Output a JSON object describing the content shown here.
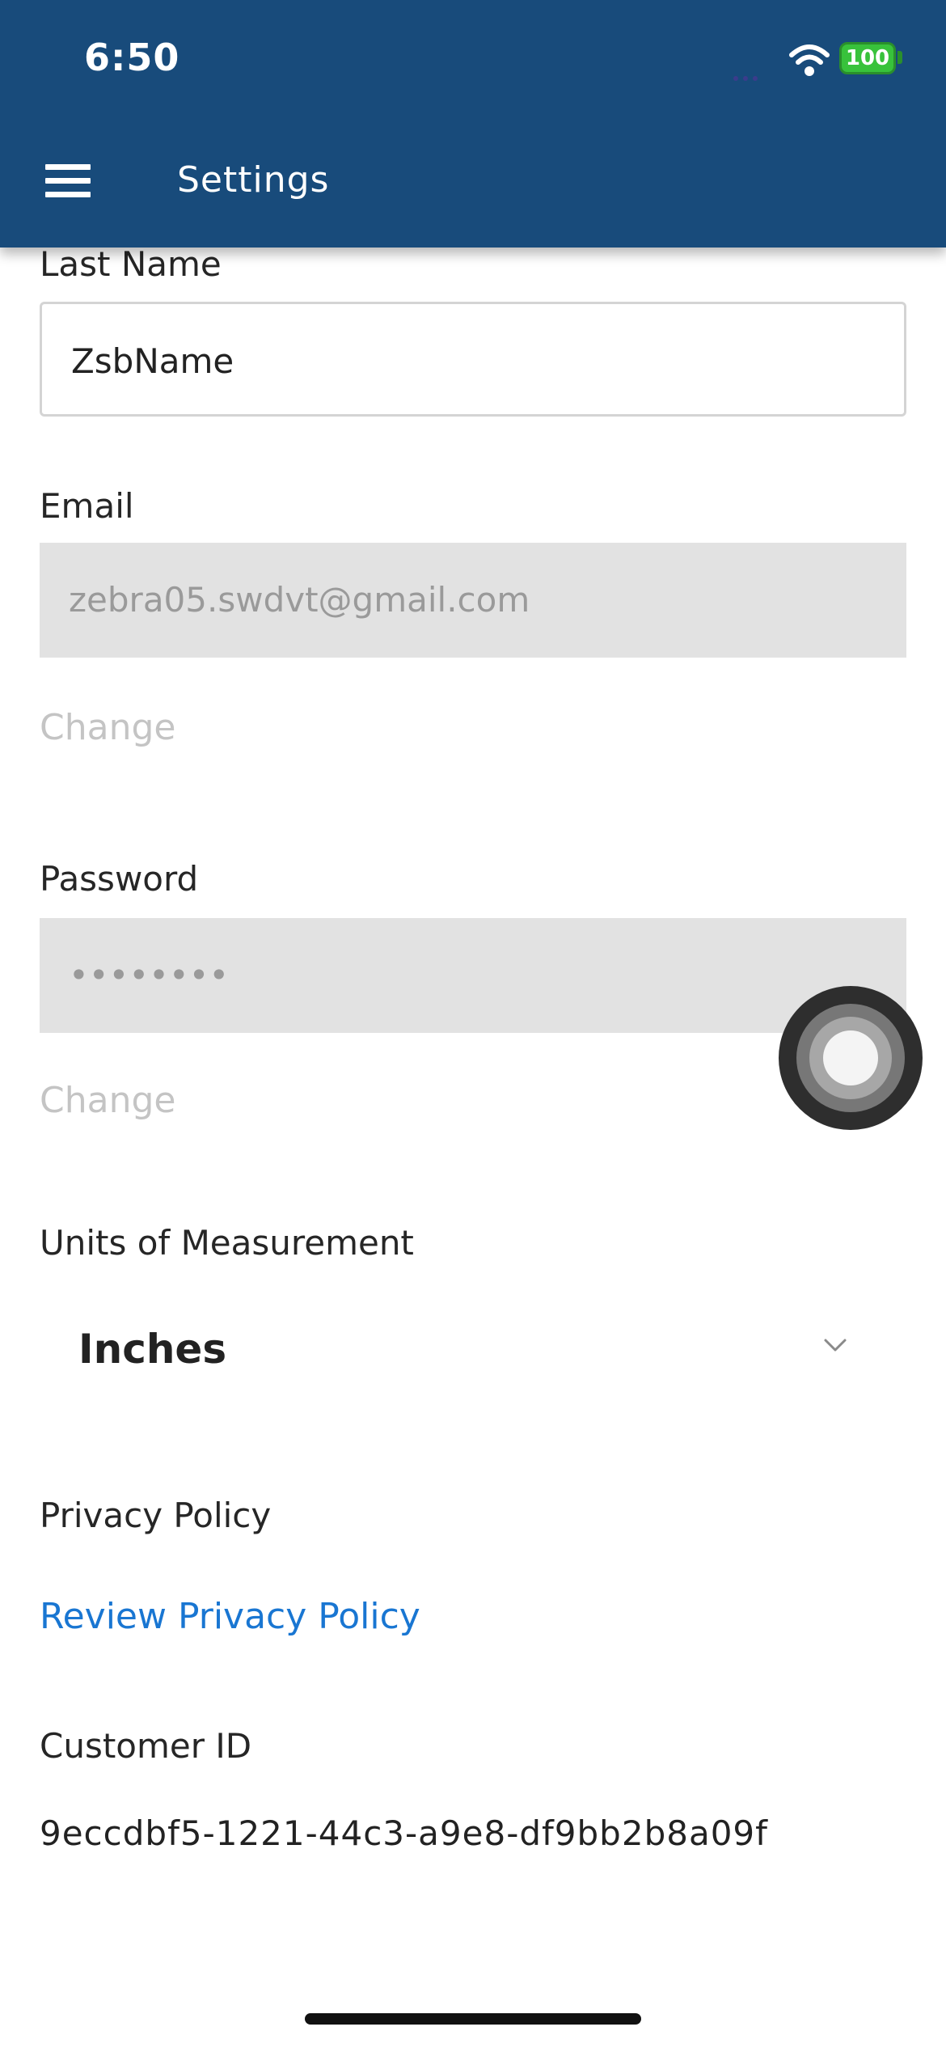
{
  "status_bar": {
    "time": "6:50",
    "battery": "100"
  },
  "header": {
    "title": "Settings"
  },
  "form": {
    "last_name": {
      "label": "Last Name",
      "value": "ZsbName"
    },
    "email": {
      "label": "Email",
      "value": "zebra05.swdvt@gmail.com",
      "change_label": "Change"
    },
    "password": {
      "label": "Password",
      "value": "••••••••",
      "change_label": "Change"
    },
    "units": {
      "label": "Units of Measurement",
      "value": "Inches"
    },
    "privacy": {
      "label": "Privacy Policy",
      "link": "Review Privacy Policy"
    },
    "customer": {
      "label": "Customer ID",
      "value": "9eccdbf5-1221-44c3-a9e8-df9bb2b8a09f"
    }
  },
  "icons": [
    "menu-icon",
    "wifi-icon",
    "battery-icon",
    "chevron-down-icon",
    "assistive-touch-icon"
  ],
  "colors": {
    "header": "#184b7b",
    "link": "#1976d2",
    "disabled_field": "#e2e2e2",
    "battery": "#38c23b"
  }
}
